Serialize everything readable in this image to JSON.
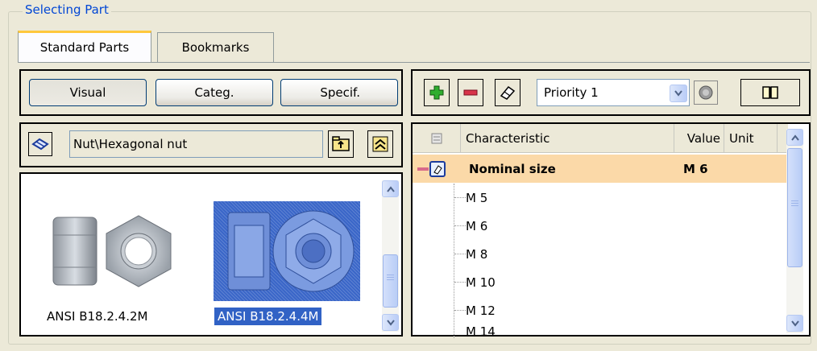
{
  "group": {
    "title": "Selecting Part"
  },
  "tabs": [
    {
      "label": "Standard Parts",
      "active": true
    },
    {
      "label": "Bookmarks",
      "active": false
    }
  ],
  "view_modes": {
    "visual": "Visual",
    "categ": "Categ.",
    "specif": "Specif."
  },
  "path": {
    "value": "Nut\\Hexagonal nut"
  },
  "toolbar": {
    "priority_value": "Priority 1"
  },
  "grid": {
    "headers": {
      "characteristic": "Characteristic",
      "value": "Value",
      "unit": "Unit"
    },
    "parent": {
      "label": "Nominal size",
      "value": "M 6"
    },
    "children": [
      "M 5",
      "M 6",
      "M 8",
      "M 10",
      "M 12",
      "M 14"
    ]
  },
  "parts": [
    {
      "caption": "ANSI B18.2.4.2M",
      "selected": false
    },
    {
      "caption": "ANSI B18.2.4.4M",
      "selected": true
    }
  ],
  "colors": {
    "accent": "#0046d5",
    "selection": "#3162c5",
    "highlight_row": "#fbd9a8",
    "active_tab_border": "#ffc83c"
  }
}
